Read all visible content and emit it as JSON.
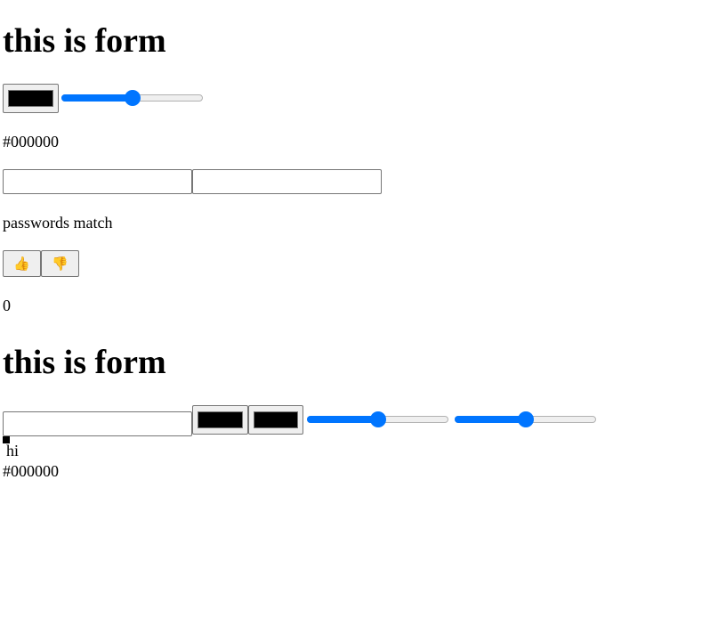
{
  "section1": {
    "heading": "this is form",
    "color_value": "#000000",
    "slider_level": 0.5,
    "hex_text": "#000000",
    "password_value": "",
    "confirm_value": "",
    "match_text": "passwords match",
    "thumbs_up_icon": "👍",
    "thumbs_down_icon": "👎",
    "count": "0"
  },
  "section2": {
    "heading": "this is form",
    "text_value": "",
    "color1_value": "#000000",
    "color2_value": "#000000",
    "slider1_level": 0.5,
    "slider2_level": 0.5,
    "hi_text": "hi",
    "hex_text": "#000000"
  },
  "colors": {
    "accent": "#0075ff",
    "swatch": "#000000"
  }
}
